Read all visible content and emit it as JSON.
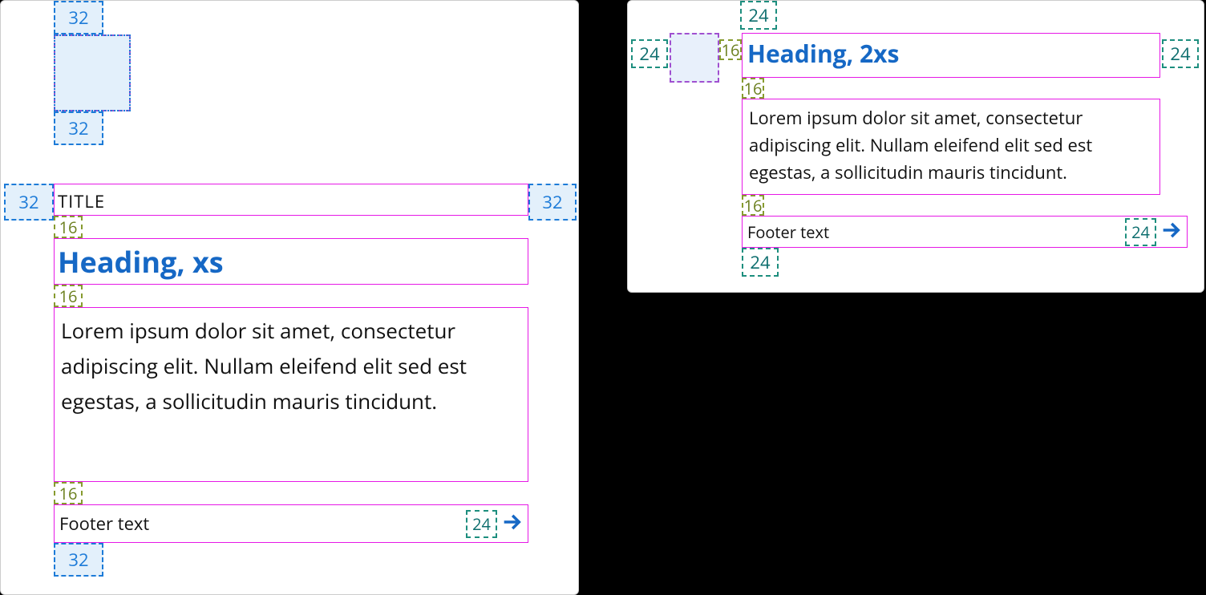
{
  "cardA": {
    "padding": {
      "top": "32",
      "imgBelow": "32",
      "left": "32",
      "right": "32",
      "bottom": "32"
    },
    "gap": {
      "titleHeading": "16",
      "headingBody": "16",
      "bodyFooter": "16"
    },
    "title": "TITLE",
    "heading": "Heading, xs",
    "body": "Lorem ipsum dolor sit amet, consectetur adipiscing elit. Nullam eleifend elit sed est egestas, a sollicitudin mauris tincidunt.",
    "footer": {
      "text": "Footer text",
      "iconGap": "24"
    }
  },
  "cardB": {
    "padding": {
      "top": "24",
      "left": "24",
      "right": "24",
      "bottom": "24"
    },
    "gap": {
      "imgHeading": "16",
      "headingBody": "16",
      "bodyFooter": "16"
    },
    "heading": "Heading, 2xs",
    "body": "Lorem ipsum dolor sit amet, consectetur adipiscing elit. Nullam eleifend elit sed est egestas, a sollicitudin mauris tincidunt.",
    "footer": {
      "text": "Footer text",
      "iconGap": "24"
    }
  }
}
